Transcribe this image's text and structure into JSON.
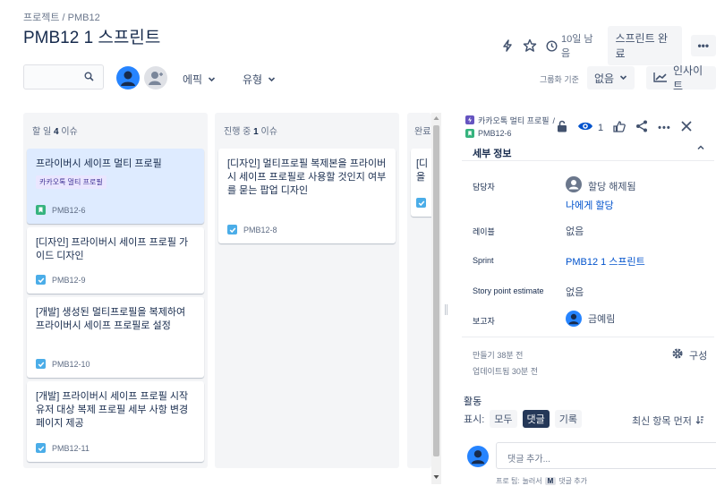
{
  "header": {
    "breadcrumb_project": "프로젝트",
    "breadcrumb_sep": "/",
    "breadcrumb_key": "PMB12",
    "title": "PMB12 1 스프린트",
    "remaining": "10일 남음",
    "complete_sprint": "스프린트 완료",
    "more": "•••",
    "icons": [
      "lightning-icon",
      "star-icon",
      "clock-icon"
    ]
  },
  "filters": {
    "search_placeholder": "",
    "epic": "에픽",
    "type": "유형",
    "group_by_label": "그룹화 기준",
    "group_by_value": "없음",
    "insights": "인사이트"
  },
  "board": {
    "columns": [
      {
        "name": "할 일",
        "count": "4",
        "suffix": "이슈",
        "cards": [
          {
            "title": "프라이버시 세이프 멀티 프로필",
            "epic": "카카오톡 멀티 프로필",
            "type": "story",
            "key": "PMB12-6"
          },
          {
            "title": "[디자인] 프라이버시 세이프 프로필 가이드 디자인",
            "type": "task",
            "key": "PMB12-9"
          },
          {
            "title": "[개발] 생성된 멀티프로필을 복제하여 프라이버시 세이프 프로필로 설정",
            "type": "task",
            "key": "PMB12-10"
          },
          {
            "title": "[개발] 프라이버시 세이프 프로필 시작 유저 대상 복제 프로필 세부 사항 변경 페이지 제공",
            "type": "task",
            "key": "PMB12-11"
          }
        ]
      },
      {
        "name": "진행 중",
        "count": "1",
        "suffix": "이슈",
        "cards": [
          {
            "title": "[디자인] 멀티프로필 복제본을 프라이버시 세이프 프로필로 사용할 것인지 여부를 묻는 팝업 디자인",
            "type": "task",
            "key": "PMB12-8"
          }
        ]
      },
      {
        "name": "완료",
        "count": "",
        "suffix": "",
        "cards": [
          {
            "title": "[디\n을",
            "type": "task",
            "key": ""
          }
        ]
      }
    ]
  },
  "panel": {
    "epic_crumb": "카카오톡 멀티 프로필",
    "crumb_sep": "/",
    "issue_key": "PMB12-6",
    "watch_count": "1",
    "details_title": "세부 정보",
    "fields": {
      "assignee_label": "담당자",
      "assignee_value": "할당 해제됨",
      "assign_me": "나에게 할당",
      "labels_label": "레이블",
      "labels_value": "없음",
      "sprint_label": "Sprint",
      "sprint_value": "PMB12 1 스프린트",
      "sp_label": "Story point estimate",
      "sp_value": "없음",
      "reporter_label": "보고자",
      "reporter_value": "금예림"
    },
    "created": "만들기 38분 전",
    "updated": "업데이트됨 30분 전",
    "configure": "구성",
    "activity": {
      "title": "활동",
      "show_label": "표시:",
      "tabs": [
        "모두",
        "댓글",
        "기록"
      ],
      "active_tab": "댓글",
      "sort": "최신 항목 먼저",
      "comment_placeholder": "댓글 추가...",
      "tip_prefix": "프로 팁:",
      "tip_press": "눌러서",
      "tip_key": "M",
      "tip_suffix": "댓글 추가"
    }
  },
  "colors": {
    "accent": "#0052cc",
    "story": "#36b37e",
    "task": "#4bade8",
    "epic": "#6554c0",
    "selected_card": "#deebff",
    "column_bg": "#f4f5f7"
  }
}
